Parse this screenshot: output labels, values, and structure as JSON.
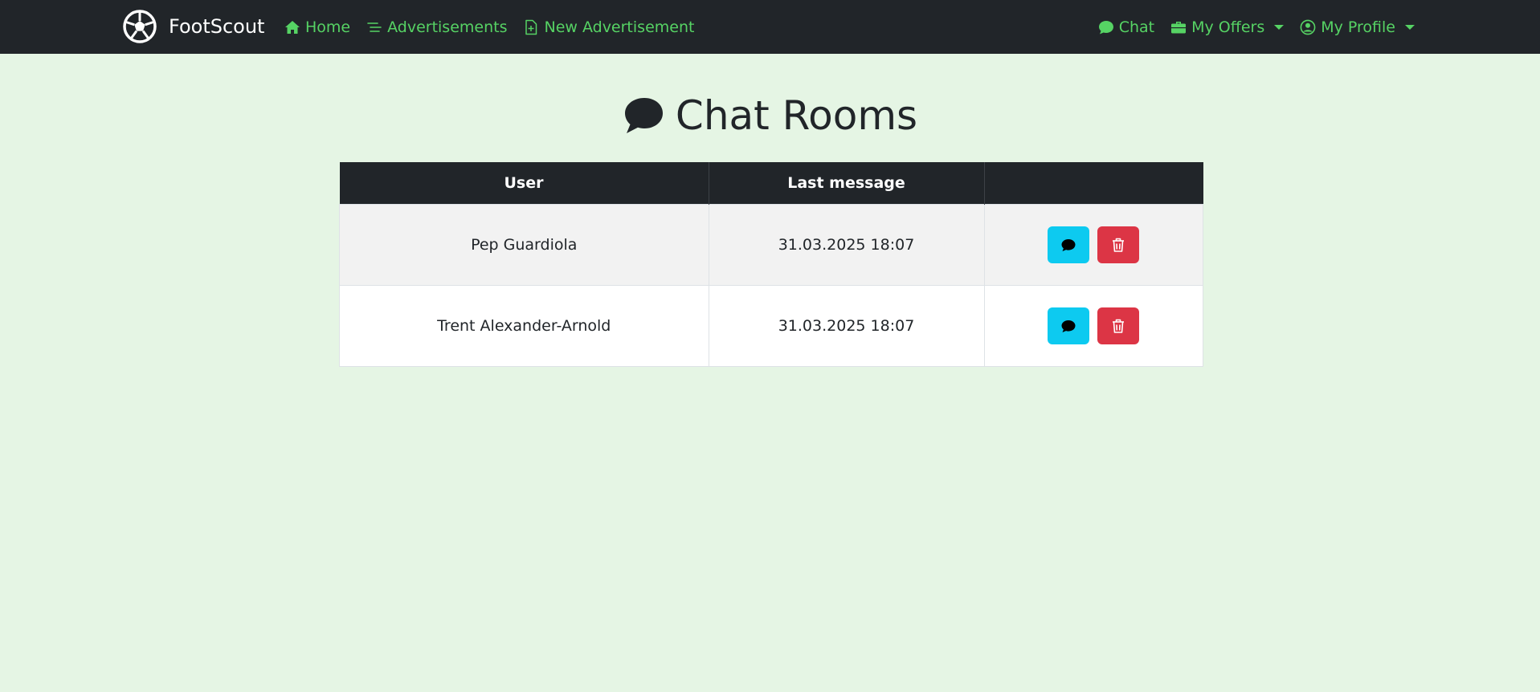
{
  "navbar": {
    "brand": "FootScout",
    "links": {
      "home": "Home",
      "advertisements": "Advertisements",
      "new_advertisement": "New Advertisement",
      "chat": "Chat",
      "my_offers": "My Offers",
      "my_profile": "My Profile"
    }
  },
  "page": {
    "title": "Chat Rooms"
  },
  "table": {
    "headers": {
      "user": "User",
      "last_message": "Last message",
      "actions": ""
    },
    "rows": [
      {
        "user": "Pep Guardiola",
        "last_message": "31.03.2025 18:07"
      },
      {
        "user": "Trent Alexander-Arnold",
        "last_message": "31.03.2025 18:07"
      }
    ]
  },
  "colors": {
    "background": "#e5f5e4",
    "navbar": "#212529",
    "link": "#56d364",
    "info_button": "#0dcaf0",
    "danger_button": "#dc3545"
  },
  "icons": {
    "brand": "soccer-ball-icon",
    "home": "house-icon",
    "advertisements": "text-lines-icon",
    "new_advertisement": "file-plus-icon",
    "chat": "chat-bubble-icon",
    "my_offers": "briefcase-icon",
    "my_profile": "person-circle-icon",
    "title": "chat-bubble-icon",
    "open_chat": "chat-bubble-icon",
    "delete": "trash-icon"
  }
}
